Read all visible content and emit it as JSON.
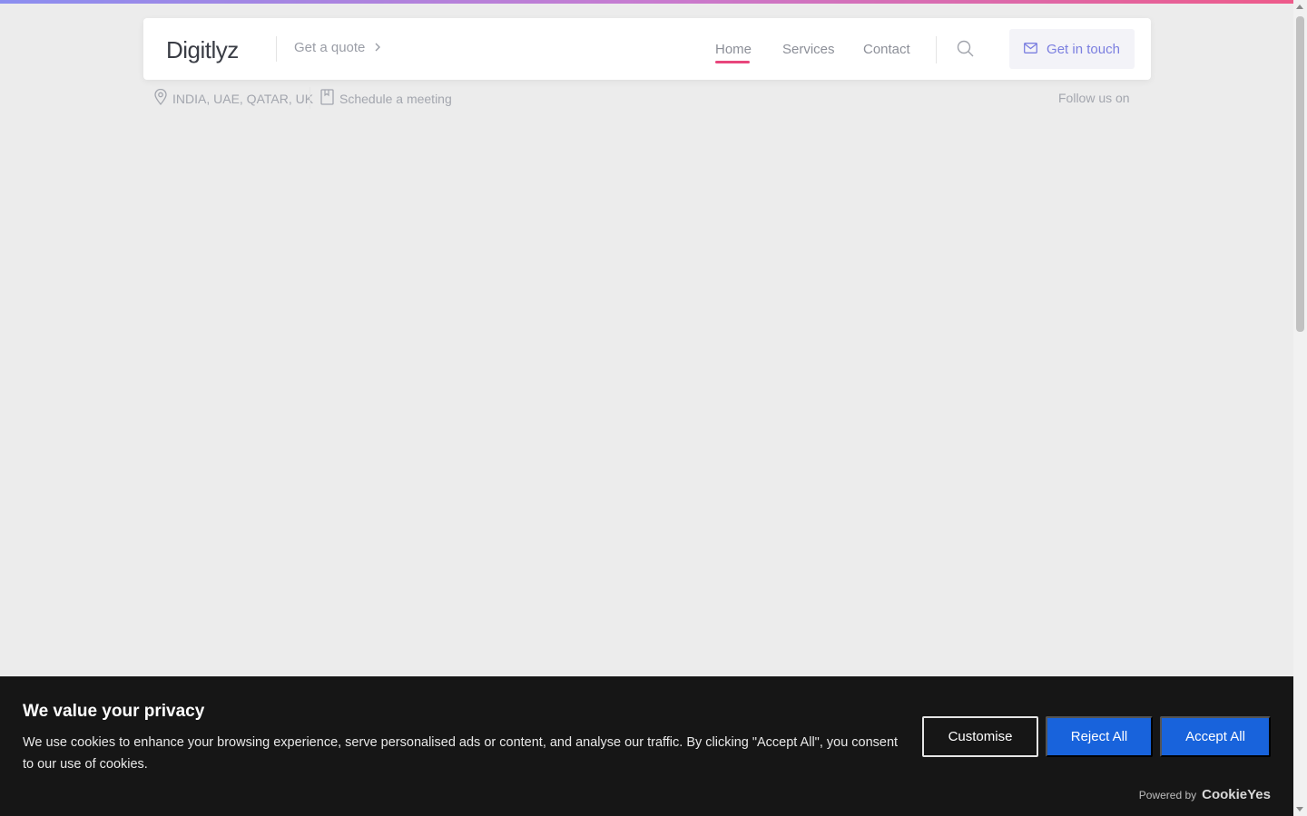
{
  "header": {
    "logo": "Digitlyz",
    "quote_label": "Get a quote",
    "nav": [
      {
        "label": "Home",
        "active": true
      },
      {
        "label": "Services",
        "active": false
      },
      {
        "label": "Contact",
        "active": false
      }
    ],
    "cta_label": "Get in touch",
    "search_icon": "search-icon",
    "cta_icon": "mail-icon"
  },
  "subbar": {
    "locations": "INDIA, UAE, QATAR, UK",
    "schedule": "Schedule a meeting",
    "follow": "Follow us on"
  },
  "cookie": {
    "title": "We value your privacy",
    "text": "We use cookies to enhance your browsing experience, serve personalised ads or content, and analyse our traffic. By clicking \"Accept All\", you consent to our use of cookies.",
    "customise_label": "Customise",
    "reject_label": "Reject All",
    "accept_label": "Accept All",
    "powered_by": "Powered by",
    "brand": "CookieYes"
  },
  "colors": {
    "accent_pink": "#e8467c",
    "cta_text": "#7b7fe0",
    "cookie_button": "#1863dc",
    "cookie_bg": "#161616"
  }
}
